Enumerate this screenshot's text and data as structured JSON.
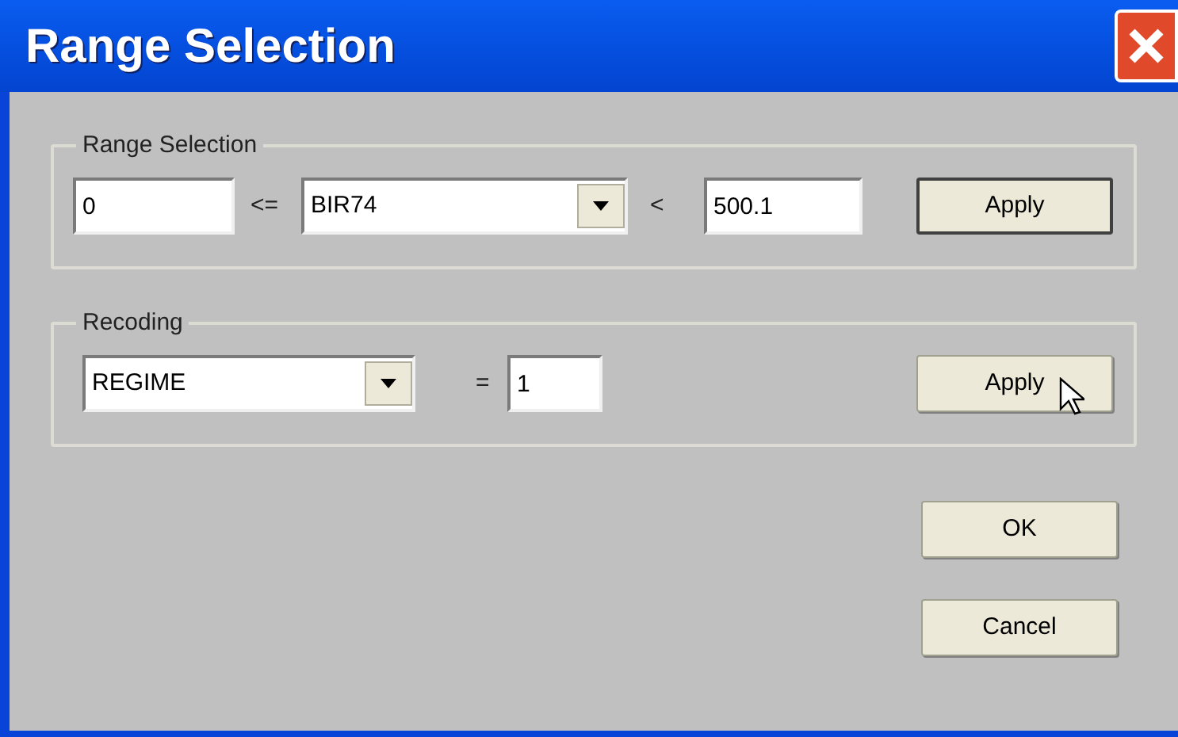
{
  "window": {
    "title": "Range Selection"
  },
  "range_selection": {
    "label": "Range Selection",
    "lower": "0",
    "lower_op": "<=",
    "variable": "BIR74",
    "upper_op": "<",
    "upper": "500.1",
    "apply": {
      "label": "Apply",
      "default": true
    }
  },
  "recoding": {
    "label": "Recoding",
    "variable": "REGIME",
    "op": "=",
    "value": "1",
    "apply": {
      "label": "Apply",
      "default": false
    }
  },
  "buttons": [
    "OK",
    "Cancel"
  ]
}
